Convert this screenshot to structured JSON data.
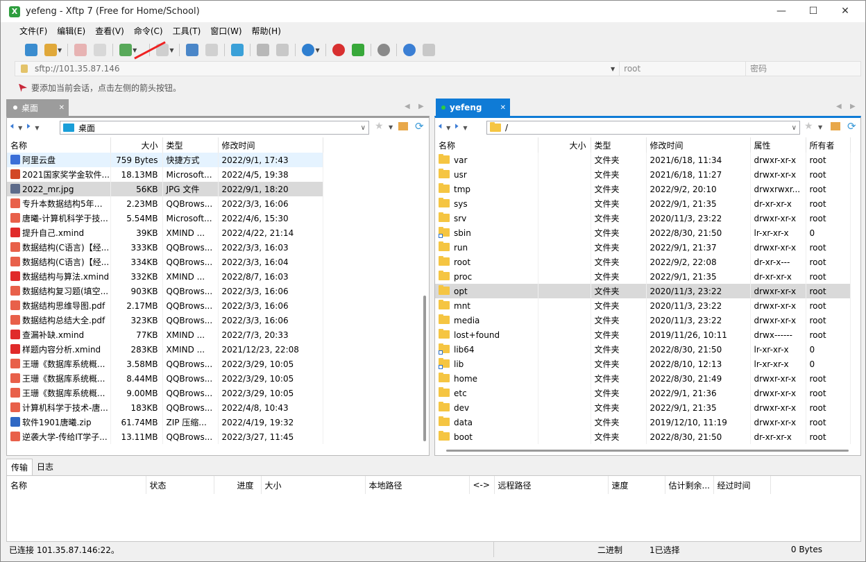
{
  "window": {
    "title": "yefeng - Xftp 7 (Free for Home/School)",
    "app_icon_label": "X"
  },
  "menu": [
    "文件(F)",
    "编辑(E)",
    "查看(V)",
    "命令(C)",
    "工具(T)",
    "窗口(W)",
    "帮助(H)"
  ],
  "address": {
    "url": "sftp://101.35.87.146",
    "user_placeholder": "root",
    "password_placeholder": "密码"
  },
  "hint": "要添加当前会话，点击左侧的箭头按钮。",
  "local": {
    "tab_label": "桌面",
    "path": "桌面",
    "columns": [
      "名称",
      "大小",
      "类型",
      "修改时间"
    ],
    "files": [
      {
        "name": "阿里云盘",
        "size": "759 Bytes",
        "type": "快捷方式",
        "modified": "2022/9/1, 17:43",
        "icon": "cloud",
        "state": "hl"
      },
      {
        "name": "2021国家奖学金软件...",
        "size": "18.13MB",
        "type": "Microsoft...",
        "modified": "2022/4/5, 19:38",
        "icon": "ppt",
        "state": ""
      },
      {
        "name": "2022_mr.jpg",
        "size": "56KB",
        "type": "JPG 文件",
        "modified": "2022/9/1, 18:20",
        "icon": "jpg",
        "state": "sel"
      },
      {
        "name": "专升本数据结构5年真...",
        "size": "2.23MB",
        "type": "QQBrows...",
        "modified": "2022/3/3, 16:06",
        "icon": "pdf",
        "state": ""
      },
      {
        "name": "唐曦-计算机科学于技...",
        "size": "5.54MB",
        "type": "Microsoft...",
        "modified": "2022/4/6, 15:30",
        "icon": "pdf",
        "state": ""
      },
      {
        "name": "提升自己.xmind",
        "size": "39KB",
        "type": "XMIND ...",
        "modified": "2022/4/22, 21:14",
        "icon": "xmind",
        "state": ""
      },
      {
        "name": "数据结构(C语言)【经...",
        "size": "333KB",
        "type": "QQBrows...",
        "modified": "2022/3/3, 16:03",
        "icon": "pdf",
        "state": ""
      },
      {
        "name": "数据结构(C语言)【经...",
        "size": "334KB",
        "type": "QQBrows...",
        "modified": "2022/3/3, 16:04",
        "icon": "pdf",
        "state": ""
      },
      {
        "name": "数据结构与算法.xmind",
        "size": "332KB",
        "type": "XMIND ...",
        "modified": "2022/8/7, 16:03",
        "icon": "xmind",
        "state": ""
      },
      {
        "name": "数据结构复习题(填空...",
        "size": "903KB",
        "type": "QQBrows...",
        "modified": "2022/3/3, 16:06",
        "icon": "pdf",
        "state": ""
      },
      {
        "name": "数据结构思维导图.pdf",
        "size": "2.17MB",
        "type": "QQBrows...",
        "modified": "2022/3/3, 16:06",
        "icon": "pdf",
        "state": ""
      },
      {
        "name": "数据结构总结大全.pdf",
        "size": "323KB",
        "type": "QQBrows...",
        "modified": "2022/3/3, 16:06",
        "icon": "pdf",
        "state": ""
      },
      {
        "name": "查漏补缺.xmind",
        "size": "77KB",
        "type": "XMIND ...",
        "modified": "2022/7/3, 20:33",
        "icon": "xmind",
        "state": ""
      },
      {
        "name": "样题内容分析.xmind",
        "size": "283KB",
        "type": "XMIND ...",
        "modified": "2021/12/23, 22:08",
        "icon": "xmind",
        "state": ""
      },
      {
        "name": "王珊《数据库系统概...",
        "size": "3.58MB",
        "type": "QQBrows...",
        "modified": "2022/3/29, 10:05",
        "icon": "pdf",
        "state": ""
      },
      {
        "name": "王珊《数据库系统概...",
        "size": "8.44MB",
        "type": "QQBrows...",
        "modified": "2022/3/29, 10:05",
        "icon": "pdf",
        "state": ""
      },
      {
        "name": "王珊《数据库系统概...",
        "size": "9.00MB",
        "type": "QQBrows...",
        "modified": "2022/3/29, 10:05",
        "icon": "pdf",
        "state": ""
      },
      {
        "name": "计算机科学于技术-唐...",
        "size": "183KB",
        "type": "QQBrows...",
        "modified": "2022/4/8, 10:43",
        "icon": "pdf",
        "state": ""
      },
      {
        "name": "软件1901唐曦.zip",
        "size": "61.74MB",
        "type": "ZIP 压缩...",
        "modified": "2022/4/19, 19:32",
        "icon": "zip",
        "state": ""
      },
      {
        "name": "逆袭大学-传给IT学子...",
        "size": "13.11MB",
        "type": "QQBrows...",
        "modified": "2022/3/27, 11:45",
        "icon": "pdf",
        "state": ""
      }
    ]
  },
  "remote": {
    "tab_label": "yefeng",
    "path": "/",
    "columns": [
      "名称",
      "大小",
      "类型",
      "修改时间",
      "属性",
      "所有者"
    ],
    "files": [
      {
        "name": "var",
        "size": "",
        "type": "文件夹",
        "modified": "2021/6/18, 11:34",
        "attr": "drwxr-xr-x",
        "owner": "root",
        "link": false,
        "state": ""
      },
      {
        "name": "usr",
        "size": "",
        "type": "文件夹",
        "modified": "2021/6/18, 11:27",
        "attr": "drwxr-xr-x",
        "owner": "root",
        "link": false,
        "state": ""
      },
      {
        "name": "tmp",
        "size": "",
        "type": "文件夹",
        "modified": "2022/9/2, 20:10",
        "attr": "drwxrwxr...",
        "owner": "root",
        "link": false,
        "state": ""
      },
      {
        "name": "sys",
        "size": "",
        "type": "文件夹",
        "modified": "2022/9/1, 21:35",
        "attr": "dr-xr-xr-x",
        "owner": "root",
        "link": false,
        "state": ""
      },
      {
        "name": "srv",
        "size": "",
        "type": "文件夹",
        "modified": "2020/11/3, 23:22",
        "attr": "drwxr-xr-x",
        "owner": "root",
        "link": false,
        "state": ""
      },
      {
        "name": "sbin",
        "size": "",
        "type": "文件夹",
        "modified": "2022/8/30, 21:50",
        "attr": "lr-xr-xr-x",
        "owner": "0",
        "link": true,
        "state": ""
      },
      {
        "name": "run",
        "size": "",
        "type": "文件夹",
        "modified": "2022/9/1, 21:37",
        "attr": "drwxr-xr-x",
        "owner": "root",
        "link": false,
        "state": ""
      },
      {
        "name": "root",
        "size": "",
        "type": "文件夹",
        "modified": "2022/9/2, 22:08",
        "attr": "dr-xr-x---",
        "owner": "root",
        "link": false,
        "state": ""
      },
      {
        "name": "proc",
        "size": "",
        "type": "文件夹",
        "modified": "2022/9/1, 21:35",
        "attr": "dr-xr-xr-x",
        "owner": "root",
        "link": false,
        "state": ""
      },
      {
        "name": "opt",
        "size": "",
        "type": "文件夹",
        "modified": "2020/11/3, 23:22",
        "attr": "drwxr-xr-x",
        "owner": "root",
        "link": false,
        "state": "sel"
      },
      {
        "name": "mnt",
        "size": "",
        "type": "文件夹",
        "modified": "2020/11/3, 23:22",
        "attr": "drwxr-xr-x",
        "owner": "root",
        "link": false,
        "state": ""
      },
      {
        "name": "media",
        "size": "",
        "type": "文件夹",
        "modified": "2020/11/3, 23:22",
        "attr": "drwxr-xr-x",
        "owner": "root",
        "link": false,
        "state": ""
      },
      {
        "name": "lost+found",
        "size": "",
        "type": "文件夹",
        "modified": "2019/11/26, 10:11",
        "attr": "drwx------",
        "owner": "root",
        "link": false,
        "state": ""
      },
      {
        "name": "lib64",
        "size": "",
        "type": "文件夹",
        "modified": "2022/8/30, 21:50",
        "attr": "lr-xr-xr-x",
        "owner": "0",
        "link": true,
        "state": ""
      },
      {
        "name": "lib",
        "size": "",
        "type": "文件夹",
        "modified": "2022/8/10, 12:13",
        "attr": "lr-xr-xr-x",
        "owner": "0",
        "link": true,
        "state": ""
      },
      {
        "name": "home",
        "size": "",
        "type": "文件夹",
        "modified": "2022/8/30, 21:49",
        "attr": "drwxr-xr-x",
        "owner": "root",
        "link": false,
        "state": ""
      },
      {
        "name": "etc",
        "size": "",
        "type": "文件夹",
        "modified": "2022/9/1, 21:36",
        "attr": "drwxr-xr-x",
        "owner": "root",
        "link": false,
        "state": ""
      },
      {
        "name": "dev",
        "size": "",
        "type": "文件夹",
        "modified": "2022/9/1, 21:35",
        "attr": "drwxr-xr-x",
        "owner": "root",
        "link": false,
        "state": ""
      },
      {
        "name": "data",
        "size": "",
        "type": "文件夹",
        "modified": "2019/12/10, 11:19",
        "attr": "drwxr-xr-x",
        "owner": "root",
        "link": false,
        "state": ""
      },
      {
        "name": "boot",
        "size": "",
        "type": "文件夹",
        "modified": "2022/8/30, 21:50",
        "attr": "dr-xr-xr-x",
        "owner": "root",
        "link": false,
        "state": ""
      }
    ]
  },
  "bottom_tabs": [
    "传输",
    "日志"
  ],
  "transfer_columns": [
    "名称",
    "状态",
    "进度",
    "大小",
    "本地路径",
    "<->",
    "远程路径",
    "速度",
    "估计剩余...",
    "经过时间"
  ],
  "status": {
    "connection": "已连接 101.35.87.146:22。",
    "mode": "二进制",
    "selection": "1已选择",
    "size": "0 Bytes"
  },
  "colors": {
    "accent": "#0f7bd6",
    "local_tab": "#9c9c9c",
    "folder": "#f5c542",
    "selected_row": "#d9d9d9"
  }
}
